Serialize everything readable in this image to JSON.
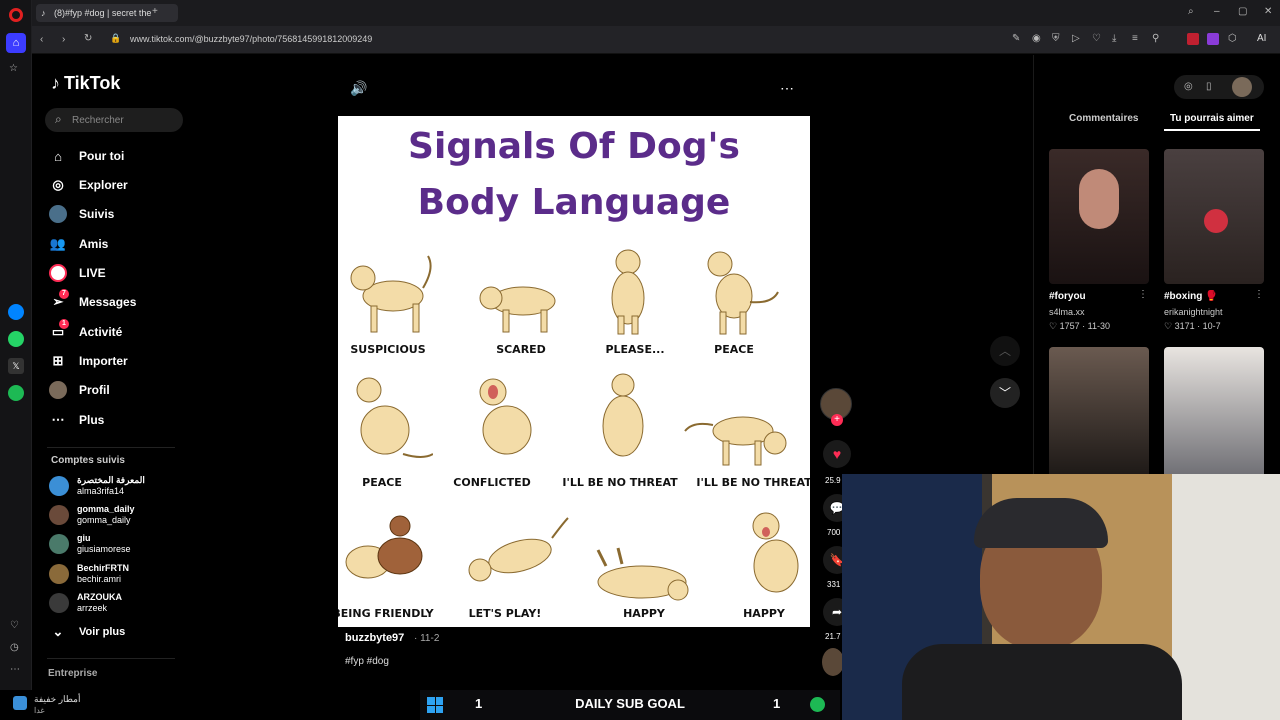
{
  "browser": {
    "tab_title": "(8)#fyp #dog | secret the",
    "url": "www.tiktok.com/@buzzbyte97/photo/7568145991812009249",
    "ai_label": "AI"
  },
  "sidebar": {
    "logo": "TikTok",
    "search_placeholder": "Rechercher",
    "items": [
      {
        "label": "Pour toi"
      },
      {
        "label": "Explorer"
      },
      {
        "label": "Suivis"
      },
      {
        "label": "Amis"
      },
      {
        "label": "LIVE"
      },
      {
        "label": "Messages",
        "badge": "7"
      },
      {
        "label": "Activité",
        "badge": "1"
      },
      {
        "label": "Importer"
      },
      {
        "label": "Profil"
      },
      {
        "label": "Plus"
      }
    ],
    "following_title": "Comptes suivis",
    "accounts": [
      {
        "name": "المعرفة المختصرة",
        "handle": "alma3rifa14"
      },
      {
        "name": "gomma_daily",
        "handle": "gomma_daily"
      },
      {
        "name": "giu",
        "handle": "giusiamorese"
      },
      {
        "name": "BechirFRTN",
        "handle": "bechir.amri"
      },
      {
        "name": "ARZOUKA",
        "handle": "arrzeek"
      }
    ],
    "see_more": "Voir plus",
    "enterprise": "Entreprise"
  },
  "post": {
    "title_line1": "Signals Of Dog's",
    "title_line2": "Body Language",
    "labels": [
      "SUSPICIOUS",
      "SCARED",
      "PLEASE...",
      "PEACE",
      "PEACE",
      "CONFLICTED",
      "I'LL BE NO THREAT",
      "I'LL BE NO THREAT",
      "BEING FRIENDLY",
      "LET'S PLAY!",
      "HAPPY",
      "HAPPY"
    ],
    "author": "buzzbyte97",
    "date": "· 11-2",
    "hashtags": "#fyp #dog",
    "likes": "25.9",
    "comments": "700",
    "saves": "331",
    "shares": "21.7"
  },
  "right_panel": {
    "tab_comments": "Commentaires",
    "tab_suggest": "Tu pourrais aimer",
    "videos": [
      {
        "caption": "#foryou",
        "author": "s4lma.xx",
        "likes": "1757",
        "date": "11-30"
      },
      {
        "caption": "#boxing 🥊",
        "author": "erikanightnight",
        "likes": "3171",
        "date": "10-7"
      }
    ]
  },
  "stream": {
    "sub_goal_label": "DAILY SUB GOAL",
    "sub_goal_left": "1",
    "sub_goal_right": "1",
    "notif_text": "أمطار خفيفة",
    "notif_sub": "غدا"
  },
  "colors": {
    "brand_purple": "#5b2c8a",
    "like_red": "#fe2c55"
  }
}
